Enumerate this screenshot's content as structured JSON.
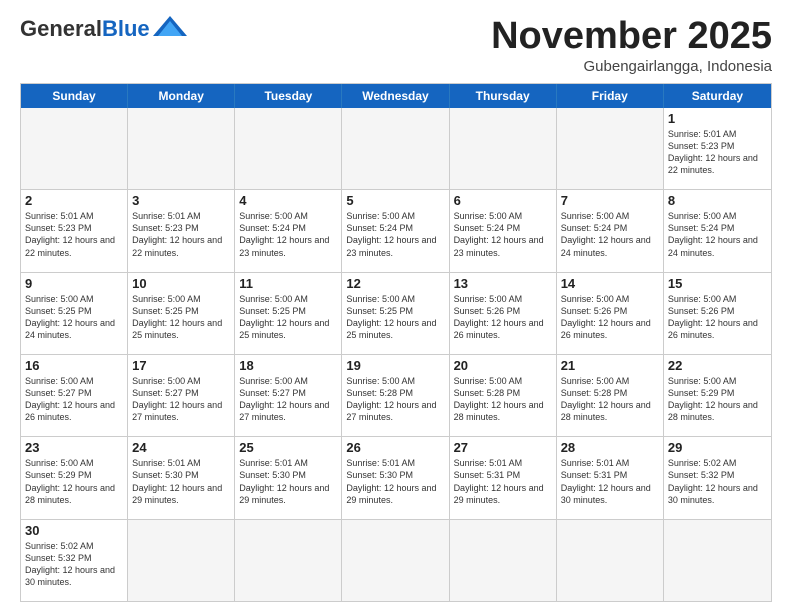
{
  "header": {
    "logo_general": "General",
    "logo_blue": "Blue",
    "month_title": "November 2025",
    "location": "Gubengairlangga, Indonesia"
  },
  "day_headers": [
    "Sunday",
    "Monday",
    "Tuesday",
    "Wednesday",
    "Thursday",
    "Friday",
    "Saturday"
  ],
  "weeks": [
    [
      {
        "num": "",
        "info": "",
        "empty": true
      },
      {
        "num": "",
        "info": "",
        "empty": true
      },
      {
        "num": "",
        "info": "",
        "empty": true
      },
      {
        "num": "",
        "info": "",
        "empty": true
      },
      {
        "num": "",
        "info": "",
        "empty": true
      },
      {
        "num": "",
        "info": "",
        "empty": true
      },
      {
        "num": "1",
        "info": "Sunrise: 5:01 AM\nSunset: 5:23 PM\nDaylight: 12 hours\nand 22 minutes.",
        "empty": false
      }
    ],
    [
      {
        "num": "2",
        "info": "Sunrise: 5:01 AM\nSunset: 5:23 PM\nDaylight: 12 hours\nand 22 minutes.",
        "empty": false
      },
      {
        "num": "3",
        "info": "Sunrise: 5:01 AM\nSunset: 5:23 PM\nDaylight: 12 hours\nand 22 minutes.",
        "empty": false
      },
      {
        "num": "4",
        "info": "Sunrise: 5:00 AM\nSunset: 5:24 PM\nDaylight: 12 hours\nand 23 minutes.",
        "empty": false
      },
      {
        "num": "5",
        "info": "Sunrise: 5:00 AM\nSunset: 5:24 PM\nDaylight: 12 hours\nand 23 minutes.",
        "empty": false
      },
      {
        "num": "6",
        "info": "Sunrise: 5:00 AM\nSunset: 5:24 PM\nDaylight: 12 hours\nand 23 minutes.",
        "empty": false
      },
      {
        "num": "7",
        "info": "Sunrise: 5:00 AM\nSunset: 5:24 PM\nDaylight: 12 hours\nand 24 minutes.",
        "empty": false
      },
      {
        "num": "8",
        "info": "Sunrise: 5:00 AM\nSunset: 5:24 PM\nDaylight: 12 hours\nand 24 minutes.",
        "empty": false
      }
    ],
    [
      {
        "num": "9",
        "info": "Sunrise: 5:00 AM\nSunset: 5:25 PM\nDaylight: 12 hours\nand 24 minutes.",
        "empty": false
      },
      {
        "num": "10",
        "info": "Sunrise: 5:00 AM\nSunset: 5:25 PM\nDaylight: 12 hours\nand 25 minutes.",
        "empty": false
      },
      {
        "num": "11",
        "info": "Sunrise: 5:00 AM\nSunset: 5:25 PM\nDaylight: 12 hours\nand 25 minutes.",
        "empty": false
      },
      {
        "num": "12",
        "info": "Sunrise: 5:00 AM\nSunset: 5:25 PM\nDaylight: 12 hours\nand 25 minutes.",
        "empty": false
      },
      {
        "num": "13",
        "info": "Sunrise: 5:00 AM\nSunset: 5:26 PM\nDaylight: 12 hours\nand 26 minutes.",
        "empty": false
      },
      {
        "num": "14",
        "info": "Sunrise: 5:00 AM\nSunset: 5:26 PM\nDaylight: 12 hours\nand 26 minutes.",
        "empty": false
      },
      {
        "num": "15",
        "info": "Sunrise: 5:00 AM\nSunset: 5:26 PM\nDaylight: 12 hours\nand 26 minutes.",
        "empty": false
      }
    ],
    [
      {
        "num": "16",
        "info": "Sunrise: 5:00 AM\nSunset: 5:27 PM\nDaylight: 12 hours\nand 26 minutes.",
        "empty": false
      },
      {
        "num": "17",
        "info": "Sunrise: 5:00 AM\nSunset: 5:27 PM\nDaylight: 12 hours\nand 27 minutes.",
        "empty": false
      },
      {
        "num": "18",
        "info": "Sunrise: 5:00 AM\nSunset: 5:27 PM\nDaylight: 12 hours\nand 27 minutes.",
        "empty": false
      },
      {
        "num": "19",
        "info": "Sunrise: 5:00 AM\nSunset: 5:28 PM\nDaylight: 12 hours\nand 27 minutes.",
        "empty": false
      },
      {
        "num": "20",
        "info": "Sunrise: 5:00 AM\nSunset: 5:28 PM\nDaylight: 12 hours\nand 28 minutes.",
        "empty": false
      },
      {
        "num": "21",
        "info": "Sunrise: 5:00 AM\nSunset: 5:28 PM\nDaylight: 12 hours\nand 28 minutes.",
        "empty": false
      },
      {
        "num": "22",
        "info": "Sunrise: 5:00 AM\nSunset: 5:29 PM\nDaylight: 12 hours\nand 28 minutes.",
        "empty": false
      }
    ],
    [
      {
        "num": "23",
        "info": "Sunrise: 5:00 AM\nSunset: 5:29 PM\nDaylight: 12 hours\nand 28 minutes.",
        "empty": false
      },
      {
        "num": "24",
        "info": "Sunrise: 5:01 AM\nSunset: 5:30 PM\nDaylight: 12 hours\nand 29 minutes.",
        "empty": false
      },
      {
        "num": "25",
        "info": "Sunrise: 5:01 AM\nSunset: 5:30 PM\nDaylight: 12 hours\nand 29 minutes.",
        "empty": false
      },
      {
        "num": "26",
        "info": "Sunrise: 5:01 AM\nSunset: 5:30 PM\nDaylight: 12 hours\nand 29 minutes.",
        "empty": false
      },
      {
        "num": "27",
        "info": "Sunrise: 5:01 AM\nSunset: 5:31 PM\nDaylight: 12 hours\nand 29 minutes.",
        "empty": false
      },
      {
        "num": "28",
        "info": "Sunrise: 5:01 AM\nSunset: 5:31 PM\nDaylight: 12 hours\nand 30 minutes.",
        "empty": false
      },
      {
        "num": "29",
        "info": "Sunrise: 5:02 AM\nSunset: 5:32 PM\nDaylight: 12 hours\nand 30 minutes.",
        "empty": false
      }
    ],
    [
      {
        "num": "30",
        "info": "Sunrise: 5:02 AM\nSunset: 5:32 PM\nDaylight: 12 hours\nand 30 minutes.",
        "empty": false
      },
      {
        "num": "",
        "info": "",
        "empty": true
      },
      {
        "num": "",
        "info": "",
        "empty": true
      },
      {
        "num": "",
        "info": "",
        "empty": true
      },
      {
        "num": "",
        "info": "",
        "empty": true
      },
      {
        "num": "",
        "info": "",
        "empty": true
      },
      {
        "num": "",
        "info": "",
        "empty": true
      }
    ]
  ]
}
